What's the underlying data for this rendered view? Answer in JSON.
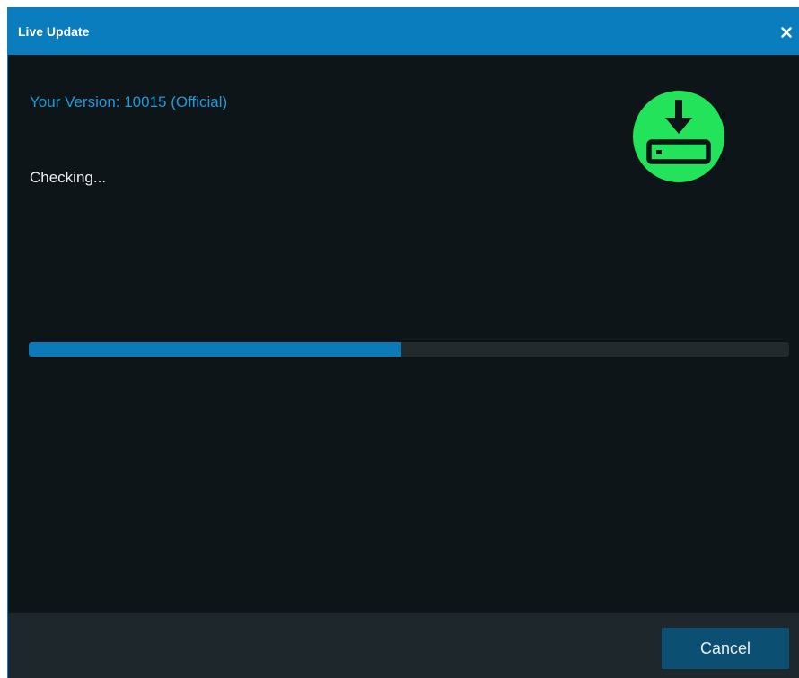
{
  "window": {
    "title": "Live Update",
    "close_icon": "close-icon"
  },
  "content": {
    "version_text": "Your Version: 10015 (Official)",
    "status_text": "Checking...",
    "update_icon": "download-icon",
    "progress_fraction": 0.49
  },
  "footer": {
    "cancel_label": "Cancel"
  },
  "colors": {
    "titlebar": "#0a7dbf",
    "background": "#0d1519",
    "accent_text": "#1d9ad8",
    "icon_green": "#22e35a",
    "progress_fill": "#0b7ab9",
    "progress_track": "#222a2e",
    "footer": "#1e272b",
    "button": "#0b4f73"
  }
}
